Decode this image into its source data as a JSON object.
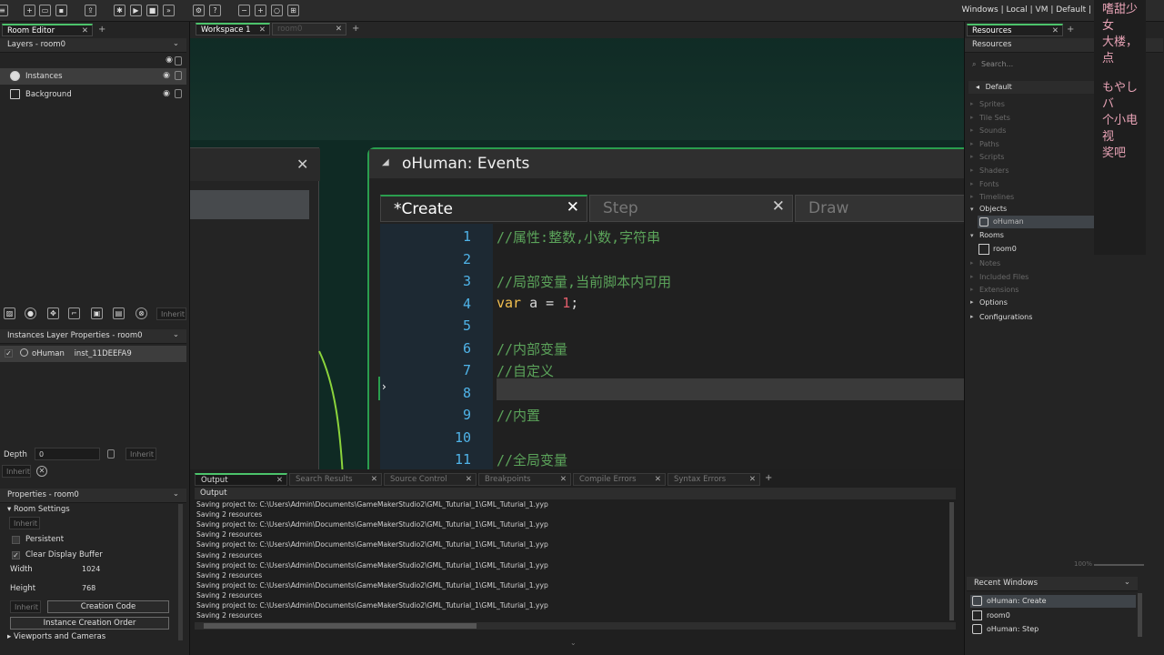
{
  "toolbar": {
    "targets": "Windows | Local | VM | Default |"
  },
  "room_editor": {
    "tab": "Room Editor",
    "layers_title": "Layers - room0",
    "layers": [
      {
        "name": "Instances"
      },
      {
        "name": "Background"
      }
    ],
    "inherit_label": "Inherit",
    "instances_props_title": "Instances Layer Properties - room0",
    "instance_row": {
      "object": "oHuman",
      "id": "inst_11DEEFA9"
    },
    "depth_label": "Depth",
    "depth_value": "0",
    "properties_title": "Properties - room0",
    "room_settings": "Room Settings",
    "persistent_label": "Persistent",
    "clear_display_label": "Clear Display Buffer",
    "width_label": "Width",
    "width_value": "1024",
    "height_label": "Height",
    "height_value": "768",
    "creation_code_button": "Creation Code",
    "instance_order_button": "Instance Creation Order",
    "viewports_label": "Viewports and Cameras"
  },
  "workspace": {
    "tabs": [
      "Workspace 1",
      "room0"
    ],
    "events_title": "oHuman: Events",
    "code_tabs": [
      "*Create",
      "Step",
      "Draw"
    ],
    "code_lines": [
      {
        "n": "1",
        "parts": [
          {
            "t": "//属性:整数,小数,字符串",
            "c": "cmt"
          }
        ]
      },
      {
        "n": "2",
        "parts": []
      },
      {
        "n": "3",
        "parts": [
          {
            "t": "//局部变量,当前脚本内可用",
            "c": "cmt"
          }
        ]
      },
      {
        "n": "4",
        "parts": [
          {
            "t": "var",
            "c": "kw"
          },
          {
            "t": " a = ",
            "c": "plain"
          },
          {
            "t": "1",
            "c": "num"
          },
          {
            "t": ";",
            "c": "plain"
          }
        ]
      },
      {
        "n": "5",
        "parts": []
      },
      {
        "n": "6",
        "parts": [
          {
            "t": "//内部变量",
            "c": "cmt"
          }
        ]
      },
      {
        "n": "7",
        "parts": [
          {
            "t": "//自定义",
            "c": "cmt"
          }
        ]
      },
      {
        "n": "8",
        "parts": []
      },
      {
        "n": "9",
        "parts": [
          {
            "t": "//内置",
            "c": "cmt"
          }
        ]
      },
      {
        "n": "10",
        "parts": []
      },
      {
        "n": "11",
        "parts": [
          {
            "t": "//全局变量",
            "c": "cmt"
          }
        ]
      }
    ]
  },
  "output": {
    "tabs": [
      "Output",
      "Search Results",
      "Source Control",
      "Breakpoints",
      "Compile Errors",
      "Syntax Errors"
    ],
    "header": "Output",
    "lines": [
      "Saving project to: C:\\Users\\Admin\\Documents\\GameMakerStudio2\\GML_Tuturial_1\\GML_Tuturial_1.yyp",
      "Saving 2 resources",
      "Saving project to: C:\\Users\\Admin\\Documents\\GameMakerStudio2\\GML_Tuturial_1\\GML_Tuturial_1.yyp",
      "Saving 2 resources",
      "Saving project to: C:\\Users\\Admin\\Documents\\GameMakerStudio2\\GML_Tuturial_1\\GML_Tuturial_1.yyp",
      "Saving 2 resources",
      "Saving project to: C:\\Users\\Admin\\Documents\\GameMakerStudio2\\GML_Tuturial_1\\GML_Tuturial_1.yyp",
      "Saving 2 resources",
      "Saving project to: C:\\Users\\Admin\\Documents\\GameMakerStudio2\\GML_Tuturial_1\\GML_Tuturial_1.yyp",
      "Saving 2 resources",
      "Saving project to: C:\\Users\\Admin\\Documents\\GameMakerStudio2\\GML_Tuturial_1\\GML_Tuturial_1.yyp",
      "Saving 2 resources"
    ]
  },
  "resources": {
    "tab": "Resources",
    "title": "Resources",
    "search_placeholder": "Search...",
    "group": "Default",
    "items": [
      "Sprites",
      "Tile Sets",
      "Sounds",
      "Paths",
      "Scripts",
      "Shaders",
      "Fonts",
      "Timelines"
    ],
    "objects_label": "Objects",
    "object_child": "oHuman",
    "rooms_label": "Rooms",
    "room_child": "room0",
    "items2": [
      "Notes",
      "Included Files",
      "Extensions"
    ],
    "options_label": "Options",
    "configs_label": "Configurations",
    "zoom": "100%",
    "recent_title": "Recent Windows",
    "recent": [
      "oHuman: Create",
      "room0",
      "oHuman: Step"
    ]
  },
  "overlay_chat": {
    "lines": [
      "嗜甜少女",
      "大楼，点",
      "もやしバ",
      "个小电视",
      "奖吧"
    ]
  }
}
